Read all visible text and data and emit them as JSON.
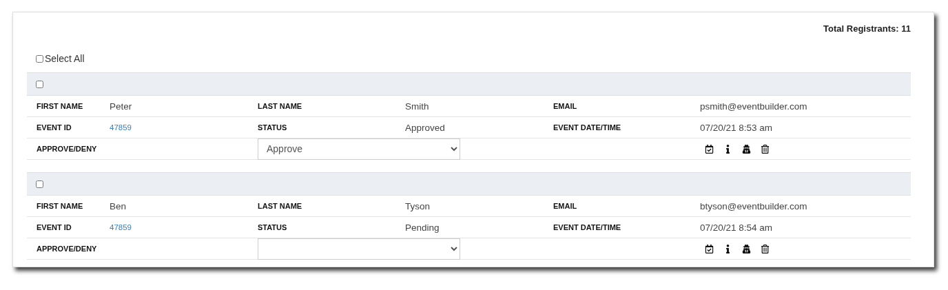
{
  "total_registrants": "Total Registrants: 11",
  "select_all": {
    "label": "Select All",
    "checked": false
  },
  "registrants": [
    {
      "checked": false,
      "first_name_label": "FIRST NAME",
      "first_name": "Peter",
      "last_name_label": "LAST NAME",
      "last_name": "Smith",
      "email_label": "EMAIL",
      "email": "psmith@eventbuilder.com",
      "event_id_label": "EVENT ID",
      "event_id": "47859",
      "status_label": "STATUS",
      "status": "Approved",
      "date_label": "EVENT DATE/TIME",
      "date": "07/20/21 8:53 am",
      "approve_label": "APPROVE/DENY",
      "approve_value": "Approve"
    },
    {
      "checked": false,
      "first_name_label": "FIRST NAME",
      "first_name": "Ben",
      "last_name_label": "LAST NAME",
      "last_name": "Tyson",
      "email_label": "EMAIL",
      "email": "btyson@eventbuilder.com",
      "event_id_label": "EVENT ID",
      "event_id": "47859",
      "status_label": "STATUS",
      "status": "Pending",
      "date_label": "EVENT DATE/TIME",
      "date": "07/20/21 8:54 am",
      "approve_label": "APPROVE/DENY"
    }
  ]
}
